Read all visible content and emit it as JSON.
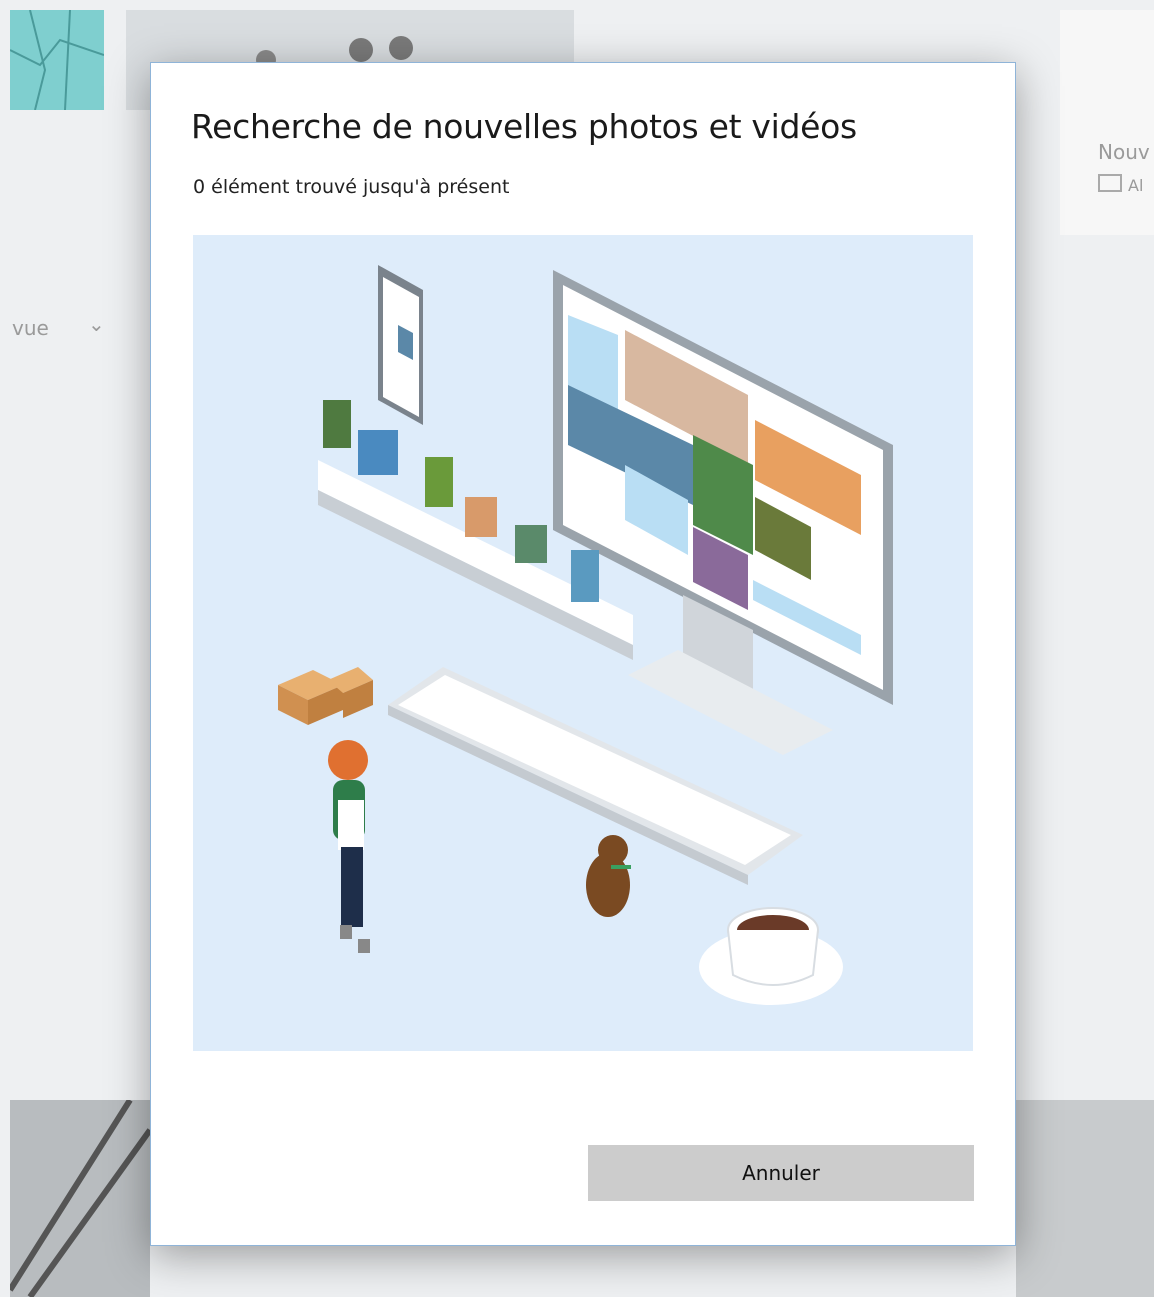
{
  "background": {
    "view_label": "vue",
    "new_label": "Nouv",
    "album_label": "Al"
  },
  "dialog": {
    "title": "Recherche de nouvelles photos et vidéos",
    "status": "0 élément trouvé jusqu'à présent",
    "cancel_label": "Annuler"
  },
  "colors": {
    "illustration_bg": "#deecfa",
    "button_bg": "#cccccc"
  }
}
